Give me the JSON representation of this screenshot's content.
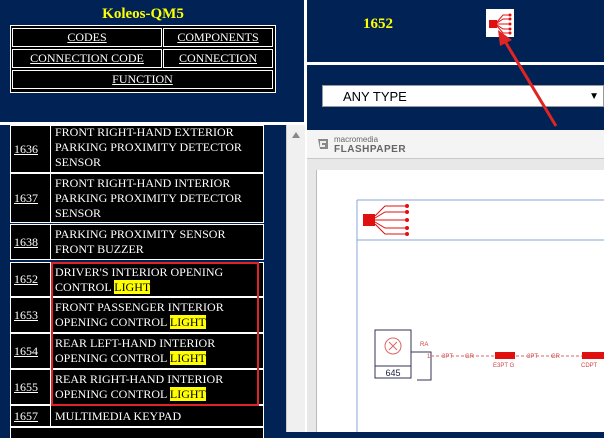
{
  "app": {
    "title": "Koleos-QM5"
  },
  "nav": {
    "codes": "CODES",
    "components": "COMPONENTS",
    "connection_code": "CONNECTION CODE",
    "connection": "CONNECTION",
    "function": "FUNCTION"
  },
  "list": {
    "rows": [
      {
        "num": "1636",
        "desc": "FRONT RIGHT-HAND EXTERIOR PARKING PROXIMITY DETECTOR SENSOR",
        "highlight": ""
      },
      {
        "num": "1637",
        "desc": "FRONT RIGHT-HAND INTERIOR PARKING PROXIMITY DETECTOR SENSOR",
        "highlight": ""
      },
      {
        "num": "1638",
        "desc": "PARKING PROXIMITY SENSOR FRONT BUZZER",
        "highlight": ""
      },
      {
        "num": "1652",
        "desc": "DRIVER'S INTERIOR OPENING CONTROL",
        "highlight": "LIGHT"
      },
      {
        "num": "1653",
        "desc": "FRONT PASSENGER INTERIOR OPENING CONTROL",
        "highlight": "LIGHT"
      },
      {
        "num": "1654",
        "desc": "REAR LEFT-HAND INTERIOR OPENING CONTROL",
        "highlight": "LIGHT"
      },
      {
        "num": "1655",
        "desc": "REAR RIGHT-HAND INTERIOR OPENING CONTROL",
        "highlight": "LIGHT"
      },
      {
        "num": "1657",
        "desc": "MULTIMEDIA KEYPAD",
        "highlight": ""
      }
    ]
  },
  "detail": {
    "number": "1652",
    "type_select": "ANY TYPE"
  },
  "viewer": {
    "logo_small": "macromedia",
    "logo_big": "FLASHPAPER"
  },
  "diagram": {
    "component_code": "645",
    "wire_ra": "RA",
    "pin_1": "1",
    "label_3pt_a": "3PT",
    "label_gr_a": "GR",
    "label_e3pt": "E3PT G",
    "label_3pt_b": "3PT",
    "label_gr_b": "GR",
    "label_cdpt": "CDPT"
  },
  "colors": {
    "background": "#002255",
    "title": "#ffff00",
    "highlight": "#ffff00",
    "annotation": "#e02424",
    "connector": "#e01010"
  }
}
